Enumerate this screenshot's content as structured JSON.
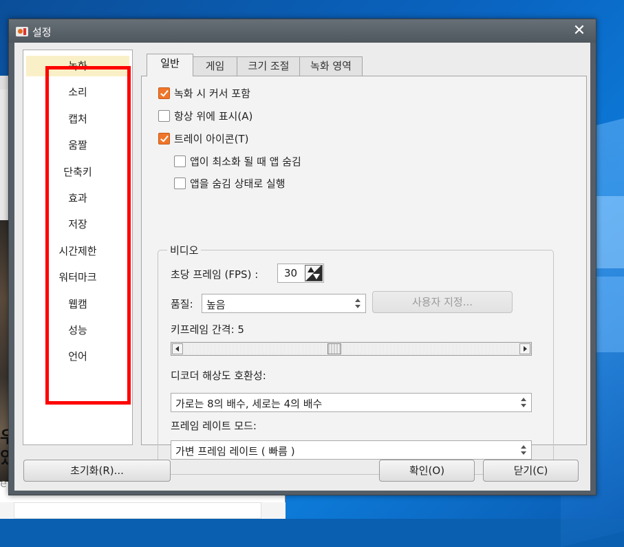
{
  "background": {
    "fragments": [
      "우",
      "있",
      "e"
    ]
  },
  "dialog": {
    "title": "설정",
    "close_glyph": "✕",
    "categories": [
      {
        "label": "녹화",
        "selected": true
      },
      {
        "label": "소리",
        "selected": false
      },
      {
        "label": "캡처",
        "selected": false
      },
      {
        "label": "움짤",
        "selected": false
      },
      {
        "label": "단축키",
        "selected": false
      },
      {
        "label": "효과",
        "selected": false
      },
      {
        "label": "저장",
        "selected": false
      },
      {
        "label": "시간제한",
        "selected": false
      },
      {
        "label": "워터마크",
        "selected": false
      },
      {
        "label": "웹캠",
        "selected": false
      },
      {
        "label": "성능",
        "selected": false
      },
      {
        "label": "언어",
        "selected": false
      }
    ],
    "tabs": [
      {
        "label": "일반",
        "active": true
      },
      {
        "label": "게임",
        "active": false
      },
      {
        "label": "크기 조절",
        "active": false
      },
      {
        "label": "녹화 영역",
        "active": false
      }
    ],
    "options": [
      {
        "label": "녹화 시 커서 포함",
        "checked": true
      },
      {
        "label": "항상 위에 표시(A)",
        "checked": false
      },
      {
        "label": "트레이 아이콘(T)",
        "checked": true
      },
      {
        "label": "앱이 최소화 될 때 앱 숨김",
        "checked": false
      },
      {
        "label": "앱을 숨김 상태로 실행",
        "checked": false
      }
    ],
    "video": {
      "group_title": "비디오",
      "fps_label": "초당 프레임 (FPS) :",
      "fps_value": "30",
      "quality_label": "품질:",
      "quality_value": "높음",
      "custom_button": "사용자 지정...",
      "custom_enabled": false,
      "keyframe_label": "키프레임 간격: 5",
      "keyframe_value": 5,
      "decoder_label": "디코더 해상도 호환성:",
      "decoder_value": "가로는 8의 배수, 세로는 4의 배수",
      "framerate_label": "프레임 레이트 모드:",
      "framerate_value": "가변 프레임 레이트 ( 빠름 )"
    },
    "buttons": {
      "reset": "초기화(R)...",
      "ok": "확인(O)",
      "close": "닫기(C)"
    }
  },
  "colors": {
    "check_accent": "#f0752a",
    "selected_item": "#faf0c8",
    "highlight_box": "#ff0000",
    "titlebar": "#5a6269"
  }
}
